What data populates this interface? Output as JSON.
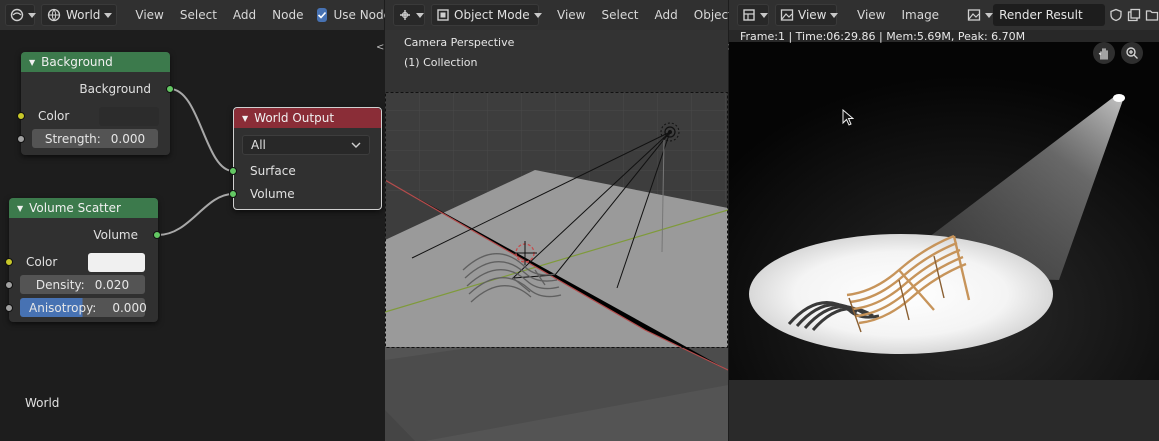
{
  "node_header": {
    "world_label": "World",
    "menus": [
      "View",
      "Select",
      "Add",
      "Node"
    ],
    "use_nodes_label": "Use Nodes",
    "use_nodes_checked": true
  },
  "nodes": {
    "background": {
      "title": "Background",
      "output": "Background",
      "color_label": "Color",
      "strength_label": "Strength:",
      "strength_value": "0.000"
    },
    "world_output": {
      "title": "World Output",
      "target": "All",
      "surface_label": "Surface",
      "volume_label": "Volume"
    },
    "volume_scatter": {
      "title": "Volume Scatter",
      "output": "Volume",
      "color_label": "Color",
      "density_label": "Density:",
      "density_value": "0.020",
      "anisotropy_label": "Anisotropy:",
      "anisotropy_value": "0.000",
      "anisotropy_fill": 0.5
    },
    "context_label": "World"
  },
  "viewport_header": {
    "mode_label": "Object Mode",
    "menus": [
      "View",
      "Select",
      "Add",
      "Object"
    ]
  },
  "viewport": {
    "camera_label": "Camera Perspective",
    "collection_label": "(1) Collection"
  },
  "image_header": {
    "view_label": "View",
    "menus": [
      "View",
      "Image"
    ],
    "image_name": "Render Result"
  },
  "render": {
    "info": "Frame:1 | Time:06:29.86 | Mem:5.69M, Peak: 6.70M"
  },
  "colors": {
    "node_green": "#3c7a4c",
    "node_red": "#8a2d37",
    "socket_green": "#63c763",
    "socket_yellow": "#c7c729",
    "accent_blue": "#4772b3",
    "checkbox_blue": "#4772b3",
    "scatter_color": "#f0f0f0",
    "bg_color": "#2c2c2c"
  },
  "icons": [
    "editor-type-icon",
    "world-icon",
    "object-mode-icon",
    "hand-icon",
    "zoom-icon",
    "image-icon",
    "shield-icon",
    "duplicate-icon",
    "folder-icon",
    "mouse-cursor-icon"
  ]
}
